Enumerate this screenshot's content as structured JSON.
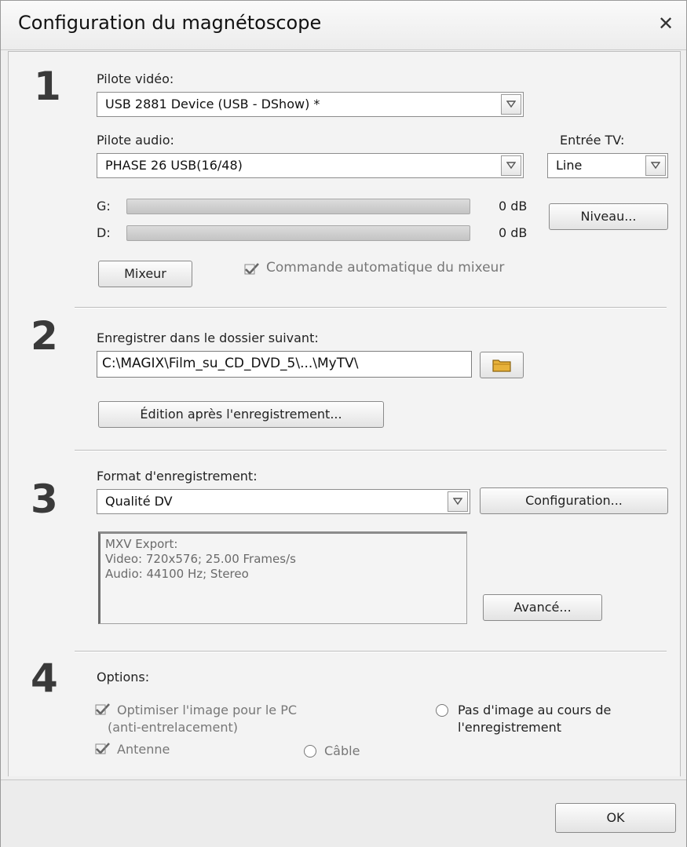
{
  "dialog": {
    "title": "Configuration du magnétoscope",
    "close_label": "✕"
  },
  "section1": {
    "number": "1",
    "video_driver_label": "Pilote vidéo:",
    "video_driver_value": "USB 2881 Device (USB - DShow) *",
    "audio_driver_label": "Pilote audio:",
    "audio_driver_value": "PHASE 26 USB(16/48)",
    "tv_input_label": "Entrée TV:",
    "tv_input_value": "Line",
    "left_label": "G:",
    "left_db": "0 dB",
    "right_label": "D:",
    "right_db": "0 dB",
    "level_button": "Niveau...",
    "mixer_button": "Mixeur",
    "auto_mixer_label": "Commande automatique du mixeur",
    "auto_mixer_checked": true
  },
  "section2": {
    "number": "2",
    "folder_label": "Enregistrer dans le dossier suivant:",
    "folder_value": "C:\\MAGIX\\Film_su_CD_DVD_5\\...\\MyTV\\",
    "edit_after_button": "Édition après l'enregistrement..."
  },
  "section3": {
    "number": "3",
    "format_label": "Format d'enregistrement:",
    "format_value": "Qualité DV",
    "config_button": "Configuration...",
    "info_lines": [
      "MXV Export:",
      "Video: 720x576; 25.00 Frames/s",
      "Audio: 44100 Hz; Stereo"
    ],
    "advanced_button": "Avancé..."
  },
  "section4": {
    "number": "4",
    "options_label": "Options:",
    "optimize_line1": "Optimiser l'image pour le PC",
    "optimize_line2": "(anti-entrelacement)",
    "optimize_checked": true,
    "no_image_line1": "Pas d'image au cours de",
    "no_image_line2": "l'enregistrement",
    "antenna_label": "Antenne",
    "antenna_checked": true,
    "cable_label": "Câble"
  },
  "footer": {
    "ok_button": "OK"
  },
  "icons": {
    "dropdown": "chevron-down-icon",
    "folder": "folder-icon",
    "check": "checkmark-icon"
  }
}
